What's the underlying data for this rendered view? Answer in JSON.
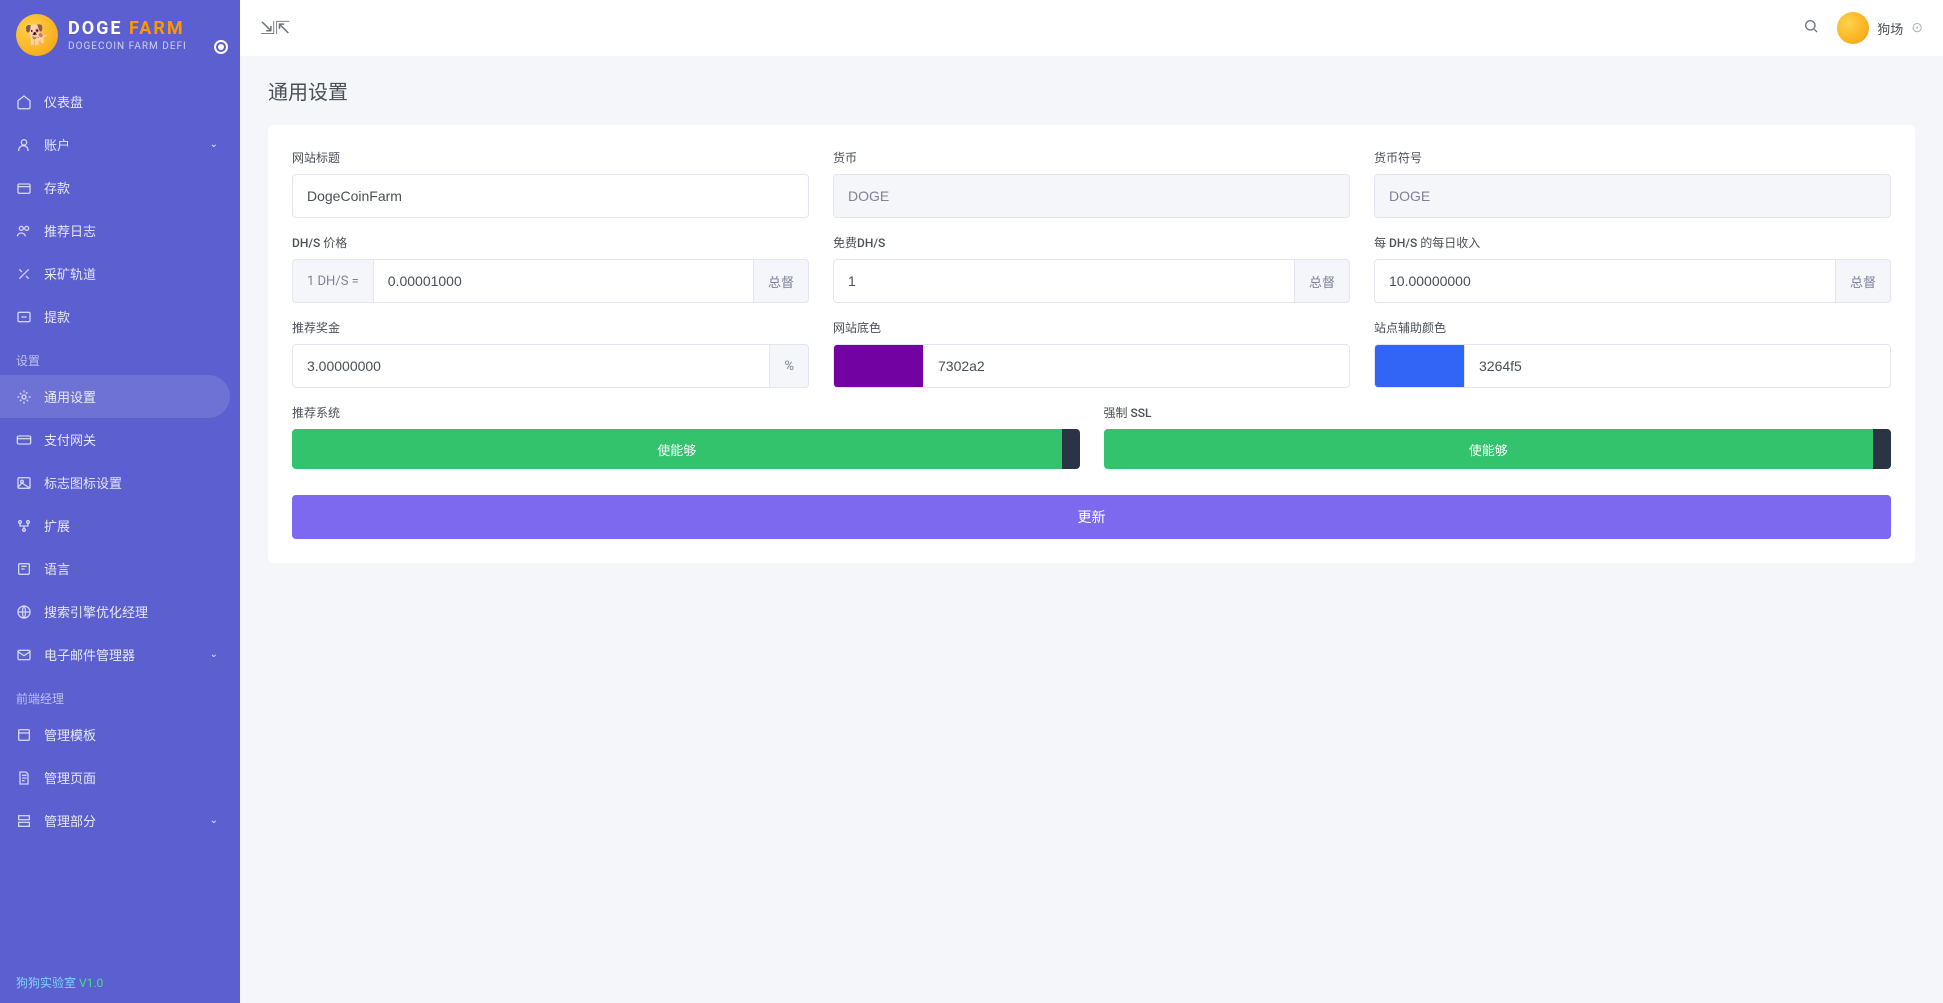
{
  "brand": {
    "word1": "DOGE",
    "word2": "FARM",
    "subtitle": "DOGECOIN FARM DEFI"
  },
  "user": {
    "name": "狗场"
  },
  "page": {
    "title": "通用设置"
  },
  "nav": {
    "items_main": [
      {
        "label": "仪表盘"
      },
      {
        "label": "账户"
      },
      {
        "label": "存款"
      },
      {
        "label": "推荐日志"
      },
      {
        "label": "采矿轨道"
      },
      {
        "label": "提款"
      }
    ],
    "section_settings": "设置",
    "items_settings": [
      {
        "label": "通用设置"
      },
      {
        "label": "支付网关"
      },
      {
        "label": "标志图标设置"
      },
      {
        "label": "扩展"
      },
      {
        "label": "语言"
      },
      {
        "label": "搜索引擎优化经理"
      },
      {
        "label": "电子邮件管理器"
      }
    ],
    "section_frontend": "前端经理",
    "items_frontend": [
      {
        "label": "管理模板"
      },
      {
        "label": "管理页面"
      },
      {
        "label": "管理部分"
      }
    ]
  },
  "footer": {
    "text1": "狗狗实验室",
    "text2": "V1.0"
  },
  "form": {
    "site_title": {
      "label": "网站标题",
      "value": "DogeCoinFarm"
    },
    "currency": {
      "label": "货币",
      "value": "DOGE"
    },
    "currency_symbol": {
      "label": "货币符号",
      "value": "DOGE"
    },
    "dhs_price": {
      "label": "DH/S 价格",
      "prefix": "1 DH/S =",
      "value": "0.00001000",
      "suffix": "总督"
    },
    "free_dhs": {
      "label": "免费DH/S",
      "value": "1",
      "suffix": "总督"
    },
    "daily_income": {
      "label": "每 DH/S 的每日收入",
      "value": "10.00000000",
      "suffix": "总督"
    },
    "referral_bonus": {
      "label": "推荐奖金",
      "value": "3.00000000",
      "suffix": "%"
    },
    "base_color": {
      "label": "网站底色",
      "value": "7302a2",
      "hex": "#7302a2"
    },
    "secondary_color": {
      "label": "站点辅助颜色",
      "value": "3264f5",
      "hex": "#3264f5"
    },
    "referral_system": {
      "label": "推荐系统",
      "status": "使能够"
    },
    "force_ssl": {
      "label": "强制 SSL",
      "status": "使能够"
    },
    "update_button": "更新"
  }
}
